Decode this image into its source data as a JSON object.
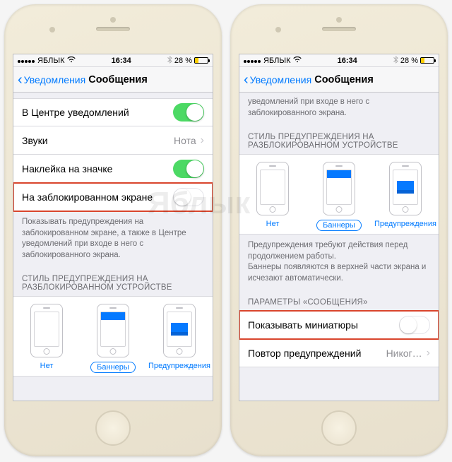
{
  "watermark": "Яблык",
  "status": {
    "carrier": "ЯБЛЫК",
    "time": "16:34",
    "battery_pct": "28 %"
  },
  "nav": {
    "back_label": "Уведомления",
    "title": "Сообщения"
  },
  "left_screen": {
    "rows": {
      "notif_center": "В Центре уведомлений",
      "sounds": "Звуки",
      "sounds_value": "Нота",
      "badge": "Наклейка на значке",
      "lock_screen": "На заблокированном экране"
    },
    "footer": "Показывать предупреждения на заблокированном экране, а также в Центре уведомлений при входе в него с заблокированного экрана.",
    "section_header": "СТИЛЬ ПРЕДУПРЕЖДЕНИЯ НА РАЗБЛОКИРОВАННОМ УСТРОЙСТВЕ"
  },
  "right_screen": {
    "top_footer": "уведомлений при входе в него с заблокированного экрана.",
    "section_header": "СТИЛЬ ПРЕДУПРЕЖДЕНИЯ НА РАЗБЛОКИРОВАННОМ УСТРОЙСТВЕ",
    "styles_footer": "Предупреждения требуют действия перед продолжением работы.\nБаннеры появляются в верхней части экрана и исчезают автоматически.",
    "params_header": "ПАРАМЕТРЫ «СООБЩЕНИЯ»",
    "show_previews": "Показывать миниатюры",
    "repeat": "Повтор предупреждений",
    "repeat_value": "Никог…"
  },
  "alert_styles": {
    "none": "Нет",
    "banners": "Баннеры",
    "alerts": "Предупреждения"
  }
}
